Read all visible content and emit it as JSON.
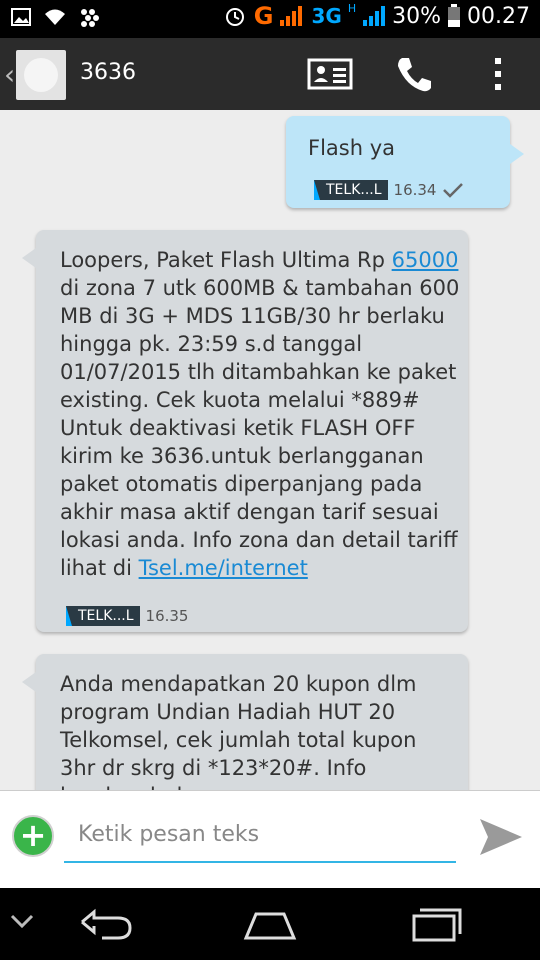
{
  "status_bar": {
    "network_type": "G",
    "network_3g": "3G",
    "network_h": "H",
    "battery": "30%",
    "time": "00.27"
  },
  "action_bar": {
    "title": "3636",
    "icons": [
      "back-chevron",
      "contact-avatar",
      "contact-card",
      "phone",
      "overflow-menu"
    ]
  },
  "messages": [
    {
      "direction": "outgoing",
      "text": "Flash ya",
      "sim": "TELK...L",
      "time": "16.34",
      "status_icon": "sent-check"
    },
    {
      "direction": "incoming",
      "text_before_amount": "Loopers, Paket Flash Ultima Rp ",
      "amount_link": "65000",
      "text_body": " di zona 7 utk 600MB & tambahan 600 MB di 3G + MDS 11GB/30 hr berlaku hingga pk. 23:59 s.d tanggal 01/07/2015 tlh ditambahkan ke paket existing. Cek kuota melalui *889# Untuk deaktivasi ketik FLASH OFF kirim ke 3636.untuk berlangganan paket otomatis diperpanjang pada akhir masa aktif dengan tarif sesuai lokasi anda. Info zona dan detail tariff lihat di ",
      "url_link": "Tsel.me/internet",
      "sim": "TELK...L",
      "time": "16.35"
    },
    {
      "direction": "incoming",
      "text": "Anda mendapatkan 20 kupon dlm program Undian Hadiah HUT 20 Telkomsel, cek jumlah total kupon 3hr dr skrg di *123*20#. Info lengkap hub"
    }
  ],
  "compose": {
    "placeholder": "Ketik pesan teks",
    "value": ""
  },
  "colors": {
    "outgoing_bubble": "#bde5f8",
    "incoming_bubble": "#d6dadd",
    "accent": "#33b5e5",
    "link": "#1a8ad4",
    "add_button": "#3ab54a"
  },
  "nav_bar": {
    "icons": [
      "hide-keyboard",
      "back",
      "home",
      "recent-apps"
    ]
  }
}
